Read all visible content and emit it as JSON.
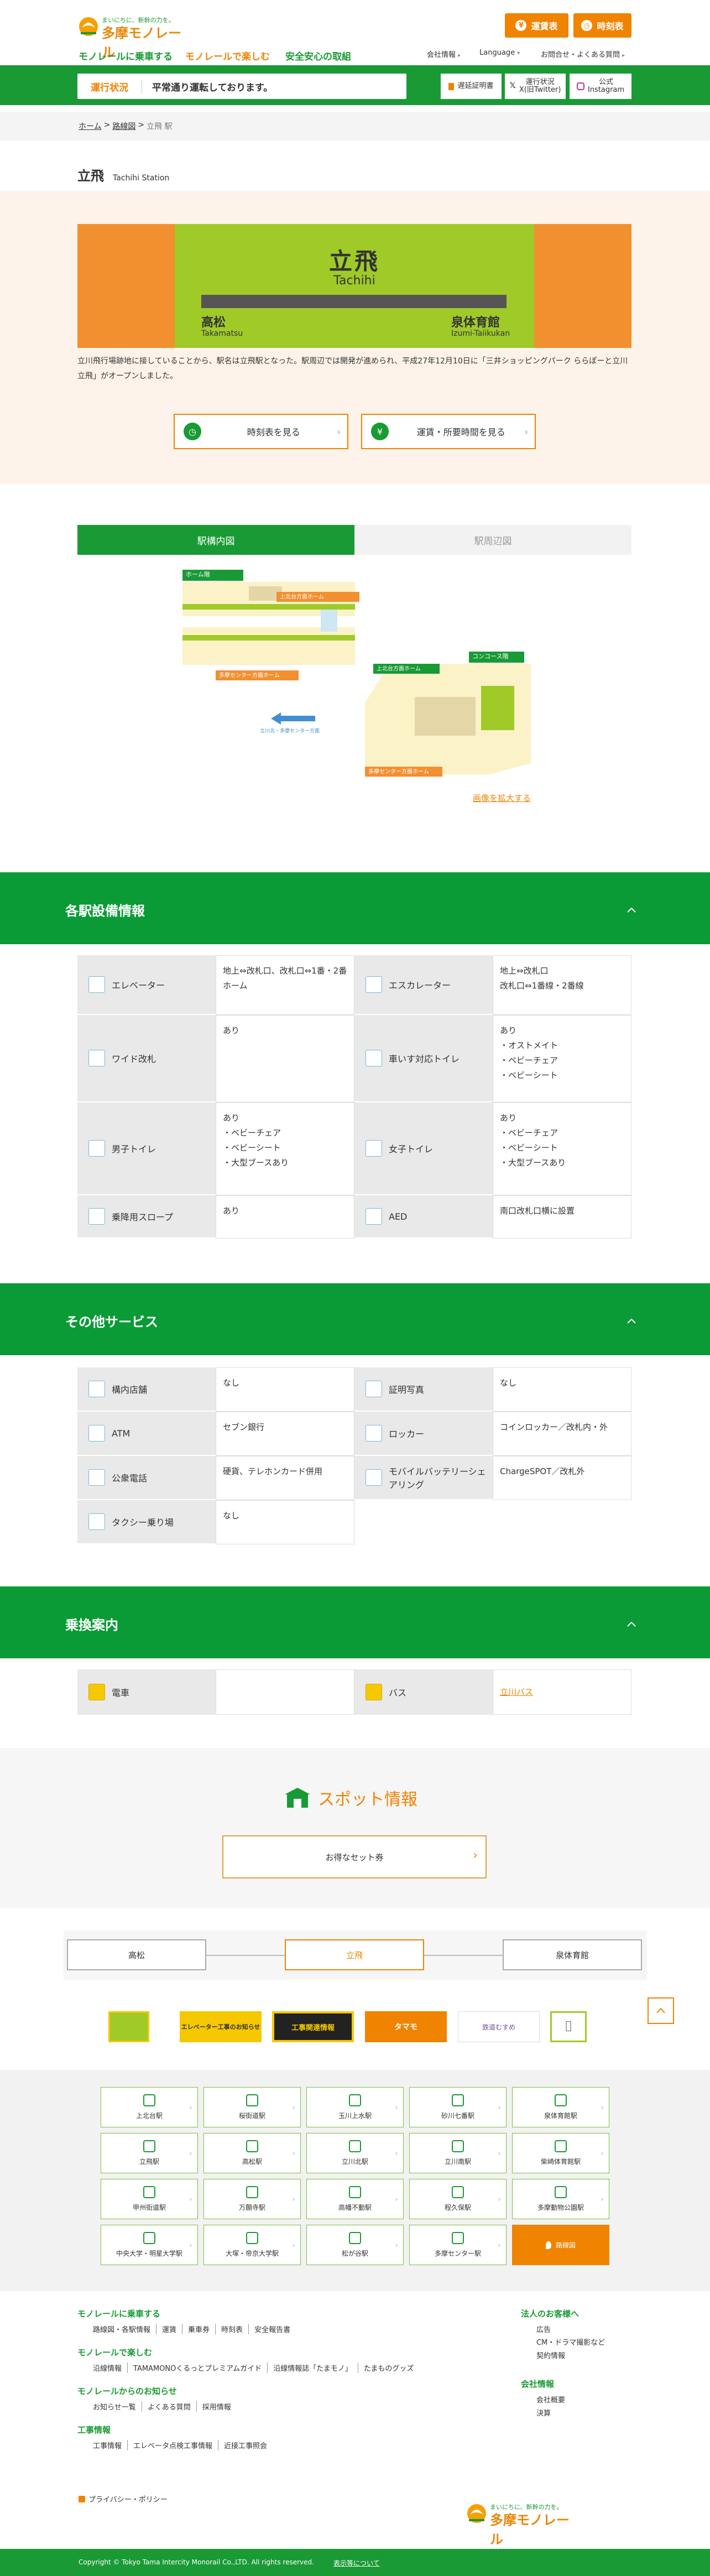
{
  "header": {
    "logo_tagline": "まいにちに、新幹の力を。",
    "logo_text": "多摩モノレール",
    "nav": [
      "モノレールに乗車する",
      "モノレールで楽しむ",
      "安全安心の取組"
    ],
    "util": [
      "会社情報",
      "Language",
      "お問合せ・よくある質問"
    ],
    "fare_button": "運賃表",
    "timetable_button": "時刻表"
  },
  "operation": {
    "tag": "運行状況",
    "message": "平常通り運転しております。",
    "certificate": "遅延証明書",
    "status_x_line1": "運行状況",
    "status_x_line2": "X(旧Twitter)",
    "insta_line1": "公式",
    "insta_line2": "Instagram"
  },
  "breadcrumb": [
    "ホーム",
    "路線図",
    "立飛 駅"
  ],
  "station": {
    "name": "立飛",
    "name_en": "Tachihi Station",
    "sign_name": "立飛",
    "sign_romaji": "Tachihi",
    "prev_name": "高松",
    "prev_romaji": "Takamatsu",
    "next_name": "泉体育館",
    "next_romaji": "Izumi-Taiikukan",
    "description": "立川飛行場跡地に接していることから、駅名は立飛駅となった。駅周辺では開発が進められ、平成27年12月10日に「三井ショッピングパーク ららぽーと立川立飛」がオープンしました。",
    "timetable_link": "時刻表を見る",
    "fare_link": "運賃・所要時間を見る"
  },
  "tabs": [
    "駅構内図",
    "駅周辺図"
  ],
  "map": {
    "home_floor": "ホーム階",
    "up_platform": "上北台方面ホーム",
    "down_platform": "多摩センター方面ホーム",
    "concourse": "コンコース階",
    "up_label": "上北台方面ホーム",
    "down_label": "多摩センター方面ホーム",
    "arrow_caption": "立川北・多摩センター方面",
    "zoom_link": "画像を拡大する"
  },
  "facilities": {
    "title": "各駅設備情報",
    "rows": [
      [
        {
          "label": "エレベーター",
          "icon": "elevator-icon",
          "value": "地上⇔改札口、改札口⇔1番・2番ホーム"
        },
        {
          "label": "エスカレーター",
          "icon": "escalator-icon",
          "value": "地上⇔改札口\n改札口⇔1番線・2番線"
        }
      ],
      [
        {
          "label": "ワイド改札",
          "icon": "wide-gate-icon",
          "value": "あり"
        },
        {
          "label": "車いす対応トイレ",
          "icon": "wheelchair-icon",
          "value": "あり\n・オストメイト\n・ベビーチェア\n・ベビーシート"
        }
      ],
      [
        {
          "label": "男子トイレ",
          "icon": "men-toilet-icon",
          "value": "あり\n・ベビーチェア\n・ベビーシート\n・大型ブースあり"
        },
        {
          "label": "女子トイレ",
          "icon": "women-toilet-icon",
          "value": "あり\n・ベビーチェア\n・ベビーシート\n・大型ブースあり"
        }
      ],
      [
        {
          "label": "乗降用スロープ",
          "icon": "slope-icon",
          "value": "あり"
        },
        {
          "label": "AED",
          "icon": "aed-icon",
          "value": "南口改札口横に設置"
        }
      ]
    ]
  },
  "services": {
    "title": "その他サービス",
    "rows": [
      [
        {
          "label": "構内店舗",
          "icon": "shop-icon",
          "value": "なし"
        },
        {
          "label": "証明写真",
          "icon": "photo-booth-icon",
          "value": "なし"
        }
      ],
      [
        {
          "label": "ATM",
          "icon": "atm-icon",
          "value": "セブン銀行"
        },
        {
          "label": "ロッカー",
          "icon": "locker-icon",
          "value": "コインロッカー／改札内・外"
        }
      ],
      [
        {
          "label": "公衆電話",
          "icon": "phone-icon",
          "value": "硬貨、テレホンカード併用"
        },
        {
          "label": "モバイルバッテリーシェアリング",
          "icon": "battery-icon",
          "value": "ChargeSPOT／改札外"
        }
      ],
      [
        {
          "label": "タクシー乗り場",
          "icon": "taxi-icon",
          "value": "なし"
        },
        null
      ]
    ]
  },
  "transfer": {
    "title": "乗換案内",
    "train_label": "電車",
    "train_value": "",
    "bus_label": "バス",
    "bus_value": "立川バス"
  },
  "spot": {
    "title": "スポット情報",
    "button": "お得なセット券"
  },
  "line_nav": {
    "prev": "高松",
    "current": "立飛",
    "next": "泉体育館"
  },
  "banners": [
    "",
    "エレベーター工事のお知らせ",
    "工事関連情報",
    "タマモ",
    "鉄道むすめ",
    ""
  ],
  "stations": [
    "上北台駅",
    "桜街道駅",
    "玉川上水駅",
    "砂川七番駅",
    "泉体育館駅",
    "立飛駅",
    "高松駅",
    "立川北駅",
    "立川南駅",
    "柴崎体育館駅",
    "甲州街道駅",
    "万願寺駅",
    "高幡不動駅",
    "程久保駅",
    "多摩動物公園駅",
    "中央大学・明星大学駅",
    "大塚・帝京大学駅",
    "松が谷駅",
    "多摩センター駅",
    "路線図"
  ],
  "footer": {
    "col1": [
      {
        "heading": "モノレールに乗車する",
        "links": [
          "路線図・各駅情報",
          "運賃",
          "乗車券",
          "時刻表",
          "安全報告書"
        ]
      },
      {
        "heading": "モノレールで楽しむ",
        "links": [
          "沿線情報",
          "TAMAMONOくるっとプレミアムガイド",
          "沿線情報誌「たまモノ」",
          "たまものグッズ"
        ]
      },
      {
        "heading": "モノレールからのお知らせ",
        "links": [
          "お知らせ一覧",
          "よくある質問",
          "採用情報"
        ]
      },
      {
        "heading": "工事情報",
        "links": [
          "工事情報",
          "エレベータ点検工事情報",
          "近接工事照会"
        ]
      }
    ],
    "col2": [
      {
        "heading": "法人のお客様へ",
        "links": [
          "広告",
          "CM・ドラマ撮影など",
          "契約情報"
        ]
      },
      {
        "heading": "会社情報",
        "links": [
          "会社概要",
          "決算"
        ]
      }
    ],
    "privacy": "プライバシー・ポリシー",
    "copyright": "Copyright © Tokyo Tama Intercity Monorail Co.,LTD. All rights reserved.",
    "site_about": "表示等について"
  },
  "colors": {
    "green": "#1a9a35",
    "orange": "#f08300",
    "sign_green": "#9fca28"
  }
}
